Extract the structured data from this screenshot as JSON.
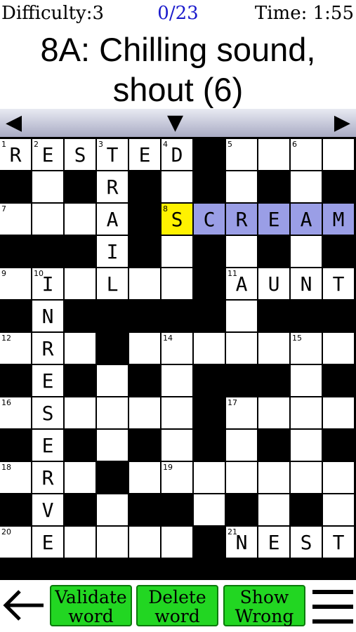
{
  "status": {
    "difficulty": "Difficulty:3",
    "progress": "0/23",
    "timer": "Time: 1:55"
  },
  "clue": {
    "line1": "8A: Chilling sound,",
    "line2": "shout (6)"
  },
  "nav": {
    "left_icon": "◀",
    "down_icon": "▼",
    "right_icon": "▶"
  },
  "grid": {
    "rows": 13,
    "cols": 11,
    "pattern": [
      "......#....",
      "#.#.#.#.#.#",
      "....#......",
      "###.#.#.#.#",
      "......#....",
      "#.#####.###",
      "...#.......",
      "#.#.#.###.#",
      "......#....",
      "#.#.#.#.#.#",
      "...#.......",
      "#.#.##.#.#.",
      "......#...."
    ],
    "letters": [
      "RESTED#    ",
      "# #R# # # #",
      "   A#SCREAM",
      "###I# # # #",
      " I L  #AUNT",
      "#N##### ###",
      " R#       ",
      "#E# # ### #",
      " S    #    ",
      "#E# # # # #",
      " R#        ",
      "#V# ## # # ",
      " E    #NEST"
    ],
    "numbers": [
      {
        "r": 0,
        "c": 0,
        "n": "1"
      },
      {
        "r": 0,
        "c": 1,
        "n": "2"
      },
      {
        "r": 0,
        "c": 3,
        "n": "3"
      },
      {
        "r": 0,
        "c": 5,
        "n": "4"
      },
      {
        "r": 0,
        "c": 7,
        "n": "5"
      },
      {
        "r": 0,
        "c": 9,
        "n": "6"
      },
      {
        "r": 2,
        "c": 0,
        "n": "7"
      },
      {
        "r": 2,
        "c": 5,
        "n": "8"
      },
      {
        "r": 4,
        "c": 0,
        "n": "9"
      },
      {
        "r": 4,
        "c": 1,
        "n": "10"
      },
      {
        "r": 4,
        "c": 7,
        "n": "11"
      },
      {
        "r": 6,
        "c": 0,
        "n": "12"
      },
      {
        "r": 6,
        "c": 3,
        "n": "13"
      },
      {
        "r": 6,
        "c": 5,
        "n": "14"
      },
      {
        "r": 6,
        "c": 9,
        "n": "15"
      },
      {
        "r": 8,
        "c": 0,
        "n": "16"
      },
      {
        "r": 8,
        "c": 7,
        "n": "17"
      },
      {
        "r": 10,
        "c": 0,
        "n": "18"
      },
      {
        "r": 10,
        "c": 5,
        "n": "19"
      },
      {
        "r": 12,
        "c": 0,
        "n": "20"
      },
      {
        "r": 12,
        "c": 7,
        "n": "21"
      }
    ],
    "selected": {
      "r": 2,
      "c": 5
    },
    "highlight_row": 2,
    "highlight_cols": [
      6,
      10
    ],
    "colors": {
      "selected": "#fff200",
      "highlight": "#9a9ee6"
    }
  },
  "buttons": {
    "validate": {
      "l1": "Validate",
      "l2": "word"
    },
    "delete": {
      "l1": "Delete",
      "l2": "word"
    },
    "show": {
      "l1": "Show",
      "l2": "Wrong"
    }
  },
  "icons": {
    "back": "back-arrow-icon",
    "menu": "hamburger-menu-icon"
  }
}
